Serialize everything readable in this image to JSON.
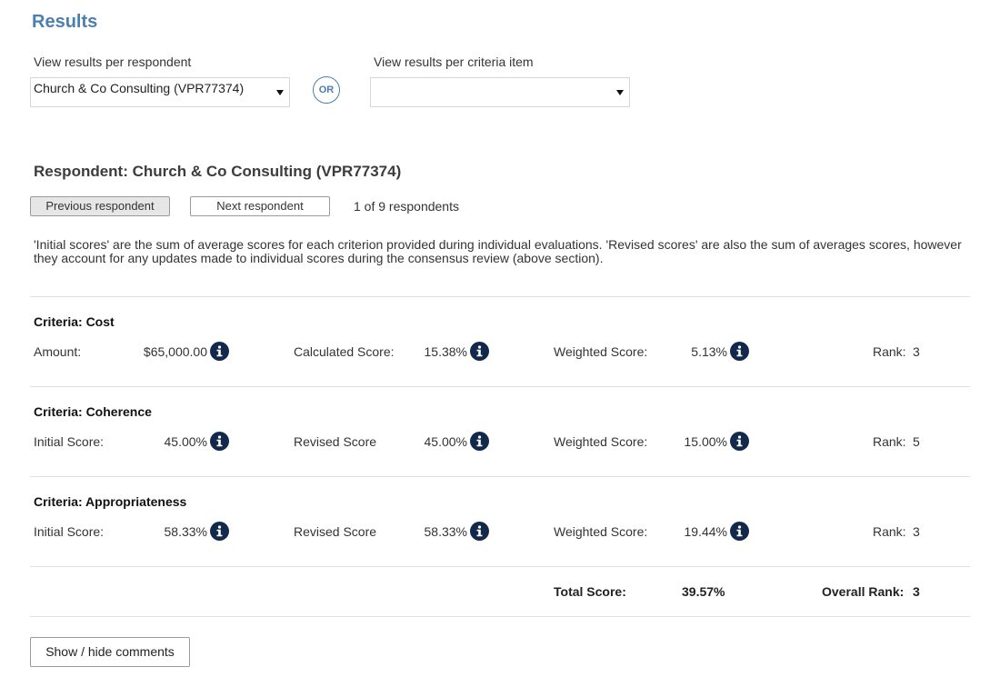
{
  "page": {
    "title": "Results"
  },
  "filters": {
    "respondent_label": "View results per respondent",
    "respondent_value": "Church & Co Consulting (VPR77374)",
    "or_label": "OR",
    "criteria_label": "View results per criteria item",
    "criteria_value": ""
  },
  "respondent": {
    "heading": "Respondent: Church & Co Consulting (VPR77374)",
    "prev_label": "Previous respondent",
    "next_label": "Next respondent",
    "count_text": "1 of 9 respondents"
  },
  "note": "'Initial scores' are the sum of average scores for each criterion provided during individual evaluations. 'Revised scores' are also the sum of averages scores, however they account for any updates made to individual scores during the consensus review (above section).",
  "criteria": [
    {
      "title": "Criteria: Cost",
      "a_label": "Amount:",
      "a_value": "$65,000.00",
      "b_label": "Calculated Score:",
      "b_value": "15.38%",
      "c_label": "Weighted Score:",
      "c_value": "5.13%",
      "rank_label": "Rank:",
      "rank_value": "3"
    },
    {
      "title": "Criteria: Coherence",
      "a_label": "Initial Score:",
      "a_value": "45.00%",
      "b_label": "Revised Score",
      "b_value": "45.00%",
      "c_label": "Weighted Score:",
      "c_value": "15.00%",
      "rank_label": "Rank:",
      "rank_value": "5"
    },
    {
      "title": "Criteria: Appropriateness",
      "a_label": "Initial Score:",
      "a_value": "58.33%",
      "b_label": "Revised Score",
      "b_value": "58.33%",
      "c_label": "Weighted Score:",
      "c_value": "19.44%",
      "rank_label": "Rank:",
      "rank_value": "3"
    }
  ],
  "totals": {
    "total_label": "Total Score:",
    "total_value": "39.57%",
    "overall_rank_label": "Overall Rank:",
    "overall_rank_value": "3"
  },
  "comments_button": "Show / hide comments",
  "icons": {
    "info": "info-icon",
    "dropdown": "caret-down-icon"
  },
  "colors": {
    "title": "#4a7fb0",
    "info_icon": "#13294b"
  }
}
